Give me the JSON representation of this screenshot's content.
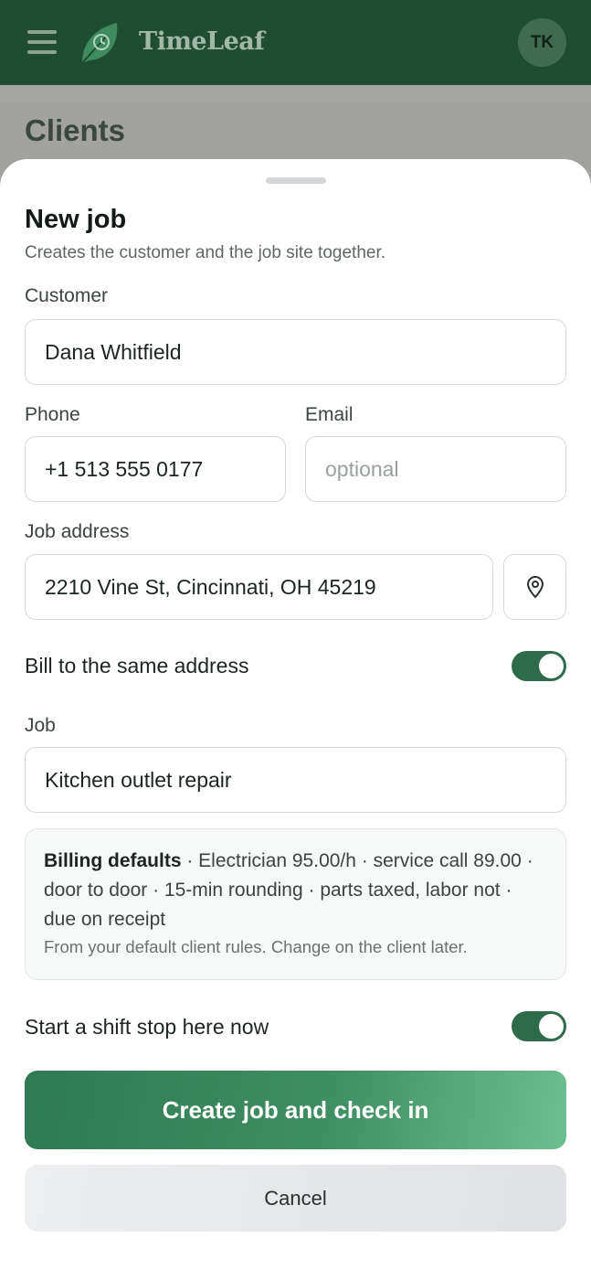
{
  "header": {
    "app_name": "TimeLeaf",
    "avatar_initials": "TK",
    "icons": {
      "menu": "menu-icon",
      "logo": "leaf-clock-icon"
    }
  },
  "background_page": {
    "title": "Clients"
  },
  "sheet": {
    "title": "New job",
    "subtitle": "Creates the customer and the job site together.",
    "customer": {
      "label": "Customer",
      "value": "Dana Whitfield"
    },
    "phone": {
      "label": "Phone",
      "value": "+1 513 555 0177"
    },
    "email": {
      "label": "Email",
      "value": "",
      "placeholder": "optional"
    },
    "address": {
      "label": "Job address",
      "value": "2210 Vine St, Cincinnati, OH 45219",
      "pin_icon": "map-pin-icon"
    },
    "bill_same": {
      "label": "Bill to the same address",
      "on": true
    },
    "job": {
      "label": "Job",
      "value": "Kitchen outlet repair"
    },
    "billing_defaults": {
      "heading": "Billing defaults",
      "details": " · Electrician 95.00/h · service call 89.00 · door to door · 15-min rounding · parts taxed, labor not · due on receipt",
      "note": "From your default client rules. Change on the client later."
    },
    "shift_stop": {
      "label": "Start a shift stop here now",
      "on": true
    },
    "primary_button": "Create job and check in",
    "cancel_button": "Cancel"
  },
  "colors": {
    "header_bg": "#1f4d34",
    "accent": "#2e6b4a",
    "primary_gradient_end": "#6cbf90"
  }
}
